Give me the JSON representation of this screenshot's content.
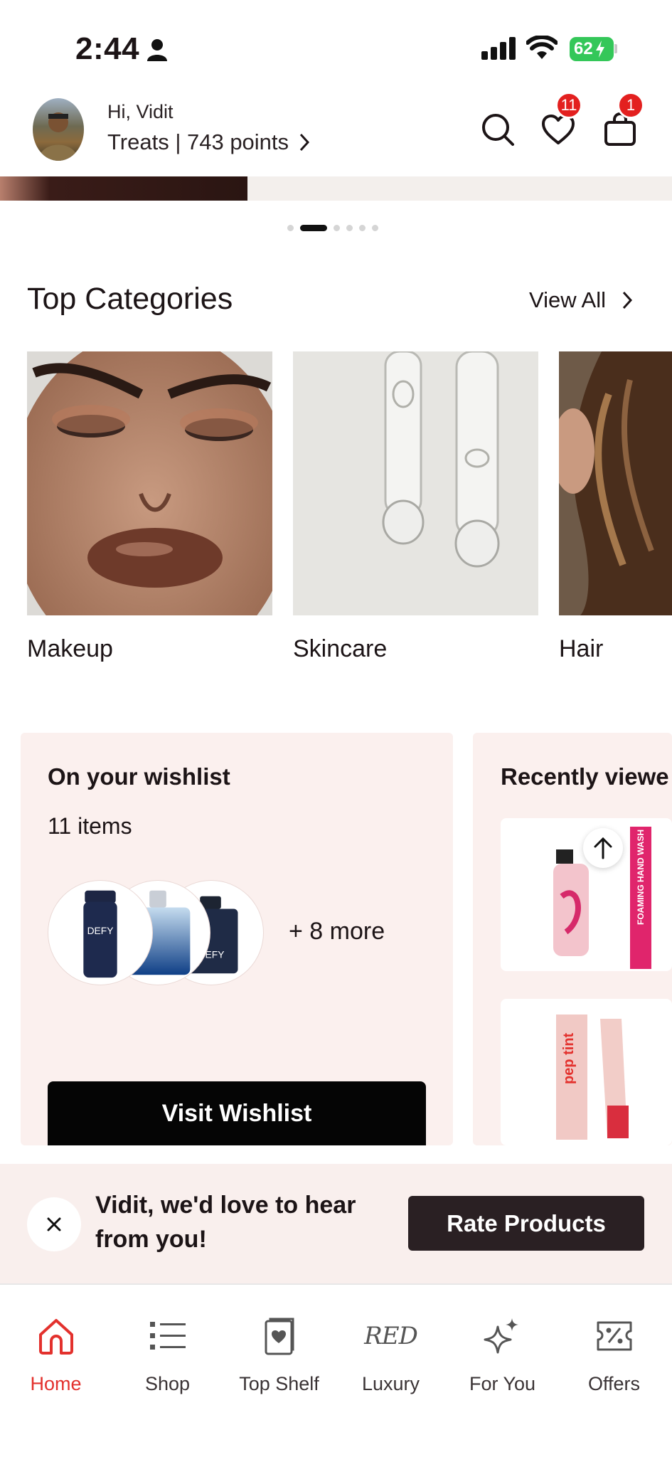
{
  "status_bar": {
    "time": "2:44",
    "battery": "62"
  },
  "header": {
    "greeting": "Hi, Vidit",
    "treats": "Treats | 743 points",
    "wishlist_badge": "11",
    "bag_badge": "1"
  },
  "carousel": {
    "dot_count": 6,
    "active_index": 1
  },
  "top_categories": {
    "title": "Top Categories",
    "view_all": "View All",
    "items": [
      {
        "label": "Makeup"
      },
      {
        "label": "Skincare"
      },
      {
        "label": "Hair"
      }
    ]
  },
  "wishlist_card": {
    "title": "On your wishlist",
    "count": "11 items",
    "more": "+ 8 more",
    "thumb_texts": [
      "DEFY",
      "DEFY"
    ],
    "button": "Visit Wishlist"
  },
  "recently_viewed": {
    "title": "Recently viewe",
    "product_texts": [
      "FOAMING HAND WASH",
      "pep tint"
    ]
  },
  "rate_bar": {
    "message": "Vidit, we'd love to hear from you!",
    "button": "Rate Products"
  },
  "bottom_nav": {
    "items": [
      {
        "label": "Home",
        "icon": "home-icon",
        "active": true
      },
      {
        "label": "Shop",
        "icon": "list-icon"
      },
      {
        "label": "Top Shelf",
        "icon": "top-shelf-icon"
      },
      {
        "label": "Luxury",
        "icon": "red-logo",
        "logo_text": "RED"
      },
      {
        "label": "For You",
        "icon": "sparkle-icon"
      },
      {
        "label": "Offers",
        "icon": "offers-icon"
      }
    ]
  },
  "colors": {
    "accent": "#e3312d",
    "badge": "#e3201f",
    "card_bg": "#fbf0ee",
    "dark_button": "#2a2023"
  }
}
